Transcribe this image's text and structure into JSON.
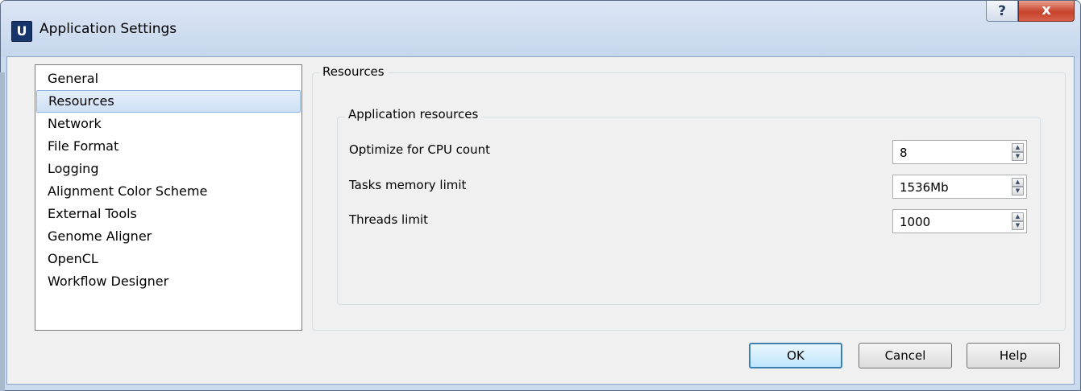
{
  "window": {
    "app_icon_letter": "U",
    "title": "Application Settings",
    "help_symbol": "?",
    "close_symbol": "x"
  },
  "sidebar": {
    "items": [
      {
        "label": "General"
      },
      {
        "label": "Resources"
      },
      {
        "label": "Network"
      },
      {
        "label": "File Format"
      },
      {
        "label": "Logging"
      },
      {
        "label": "Alignment Color Scheme"
      },
      {
        "label": "External Tools"
      },
      {
        "label": "Genome Aligner"
      },
      {
        "label": "OpenCL"
      },
      {
        "label": "Workflow Designer"
      }
    ],
    "selected": "Resources"
  },
  "page": {
    "title": "Resources",
    "group_title": "Application resources",
    "fields": [
      {
        "label": "Optimize for CPU count",
        "value": "8"
      },
      {
        "label": "Tasks memory limit",
        "value": "1536Mb"
      },
      {
        "label": "Threads limit",
        "value": "1000"
      }
    ]
  },
  "buttons": {
    "ok": "OK",
    "cancel": "Cancel",
    "help": "Help"
  },
  "colors": {
    "selection": "#cfe0f5",
    "default_button_border": "#3c7fb1",
    "close_button": "#c7422a"
  },
  "icons": {
    "app": "ugene-app-icon",
    "spin_up": "triangle-up",
    "spin_down": "triangle-down"
  }
}
